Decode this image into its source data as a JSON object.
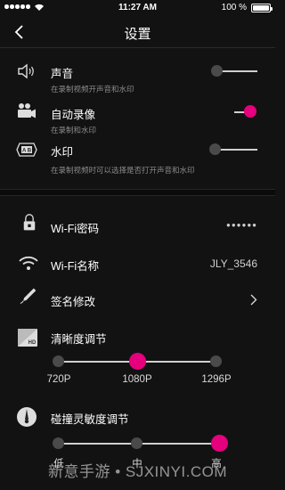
{
  "status_bar": {
    "time": "11:27 AM",
    "battery": "100 %"
  },
  "nav": {
    "title": "设置"
  },
  "recording": [
    {
      "label": "声音",
      "desc": "在录制视频开声音和水印",
      "on": false,
      "icon": "speaker-icon"
    },
    {
      "label": "自动录像",
      "desc": "在录制和水印",
      "on": true,
      "icon": "video-camera-icon"
    },
    {
      "label": "水印",
      "desc": "在录制视频时可以选择是否打开声音和水印",
      "on": false,
      "icon": "watermark-icon"
    }
  ],
  "wifi_password": {
    "label": "Wi-Fi密码",
    "value": "●●●●●●"
  },
  "wifi_name": {
    "label": "Wi-Fi名称",
    "value": "JLY_3546"
  },
  "signature": {
    "label": "签名修改"
  },
  "resolution": {
    "label": "清晰度调节",
    "options": [
      "720P",
      "1080P",
      "1296P"
    ],
    "selected": "1080P"
  },
  "collision": {
    "label": "碰撞灵敏度调节",
    "options": [
      "低",
      "中",
      "高"
    ],
    "selected": "高"
  },
  "watermark_text": "新意手游 • SJXINYI.COM",
  "colors": {
    "accent": "#e6007e",
    "background": "#121212",
    "knob_off": "#4a4a4a"
  }
}
